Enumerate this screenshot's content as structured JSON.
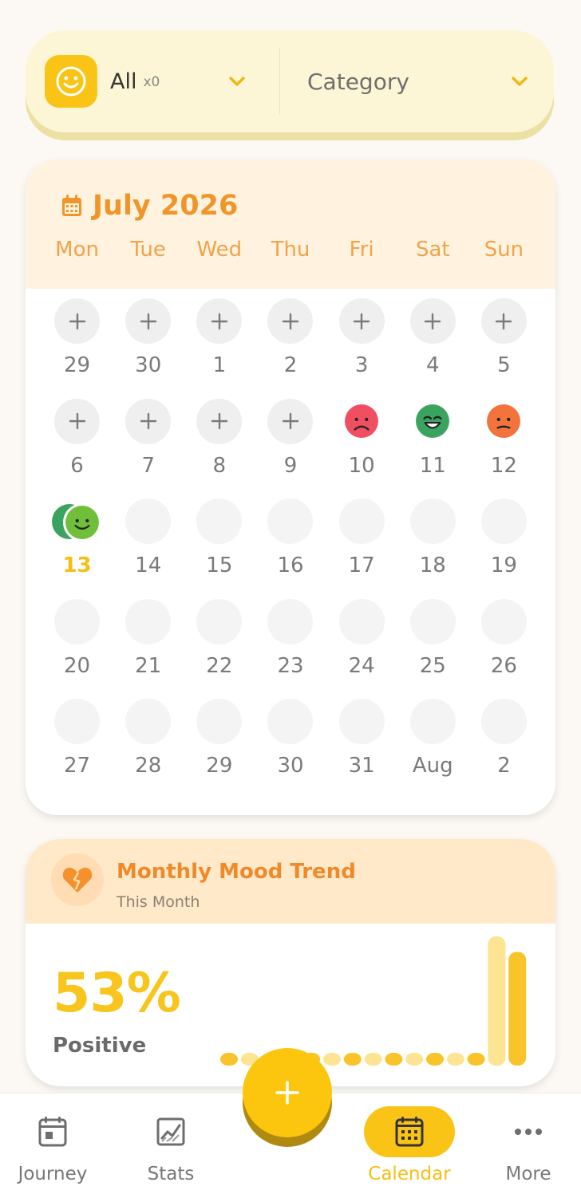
{
  "filter": {
    "mood_label": "All",
    "mood_count": "x0",
    "category_label": "Category",
    "icons": {
      "mood": "smiley-icon",
      "chevron": "chevron-down-icon"
    }
  },
  "calendar": {
    "title": "July 2026",
    "weekdays": [
      "Mon",
      "Tue",
      "Wed",
      "Thu",
      "Fri",
      "Sat",
      "Sun"
    ],
    "days": [
      {
        "label": "29",
        "state": "add"
      },
      {
        "label": "30",
        "state": "add"
      },
      {
        "label": "1",
        "state": "add"
      },
      {
        "label": "2",
        "state": "add"
      },
      {
        "label": "3",
        "state": "add"
      },
      {
        "label": "4",
        "state": "add"
      },
      {
        "label": "5",
        "state": "add"
      },
      {
        "label": "6",
        "state": "add"
      },
      {
        "label": "7",
        "state": "add"
      },
      {
        "label": "8",
        "state": "add"
      },
      {
        "label": "9",
        "state": "add"
      },
      {
        "label": "10",
        "state": "mood",
        "mood": "sad"
      },
      {
        "label": "11",
        "state": "mood",
        "mood": "grin"
      },
      {
        "label": "12",
        "state": "mood",
        "mood": "meh"
      },
      {
        "label": "13",
        "state": "today",
        "mood": "happy-stack"
      },
      {
        "label": "14",
        "state": "empty"
      },
      {
        "label": "15",
        "state": "empty"
      },
      {
        "label": "16",
        "state": "empty"
      },
      {
        "label": "17",
        "state": "empty"
      },
      {
        "label": "18",
        "state": "empty"
      },
      {
        "label": "19",
        "state": "empty"
      },
      {
        "label": "20",
        "state": "empty"
      },
      {
        "label": "21",
        "state": "empty"
      },
      {
        "label": "22",
        "state": "empty"
      },
      {
        "label": "23",
        "state": "empty"
      },
      {
        "label": "24",
        "state": "empty"
      },
      {
        "label": "25",
        "state": "empty"
      },
      {
        "label": "26",
        "state": "empty"
      },
      {
        "label": "27",
        "state": "empty"
      },
      {
        "label": "28",
        "state": "empty"
      },
      {
        "label": "29",
        "state": "empty"
      },
      {
        "label": "30",
        "state": "empty"
      },
      {
        "label": "31",
        "state": "empty"
      },
      {
        "label": "Aug",
        "state": "empty"
      },
      {
        "label": "2",
        "state": "empty"
      }
    ]
  },
  "trend": {
    "title": "Monthly Mood Trend",
    "subtitle": "This Month",
    "percent": "53%",
    "label": "Positive",
    "bars": [
      0.07,
      0.07,
      0.07,
      0.07,
      0.07,
      0.07,
      0.07,
      0.07,
      0.07,
      0.07,
      0.07,
      0.07,
      0.07,
      1.0,
      0.88
    ],
    "colors": {
      "strong": "#f9c42a",
      "light": "#fde492"
    }
  },
  "nav": {
    "items": [
      {
        "label": "Journey",
        "icon": "journey-icon"
      },
      {
        "label": "Stats",
        "icon": "stats-icon"
      },
      {
        "label": "Calendar",
        "icon": "calendar-icon",
        "active": true
      },
      {
        "label": "More",
        "icon": "more-icon"
      }
    ],
    "fab_icon": "plus-icon"
  },
  "colors": {
    "accent": "#f9c416",
    "orange": "#f0952a"
  }
}
